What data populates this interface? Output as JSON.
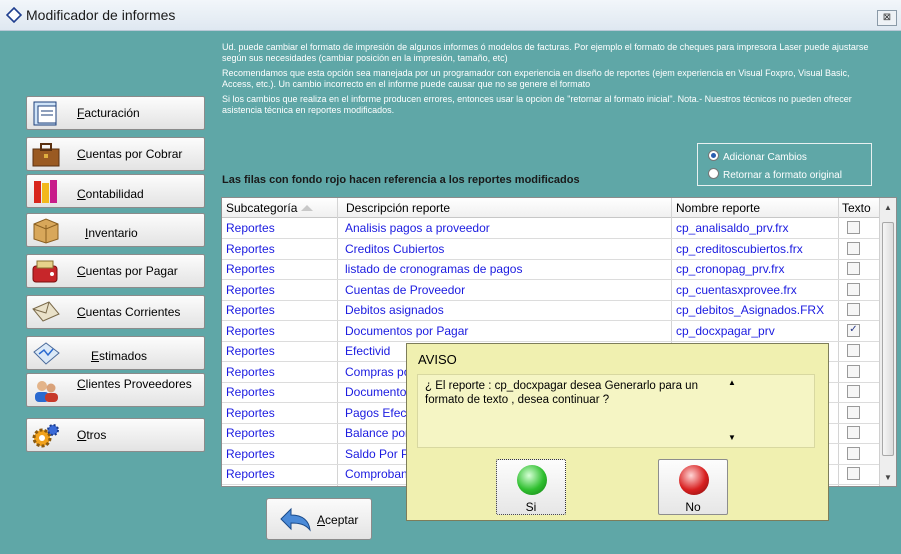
{
  "window": {
    "title": "Modificador de informes",
    "close": "⊠"
  },
  "sidebar": {
    "items": [
      {
        "label": "Facturación",
        "icon": "invoice-icon"
      },
      {
        "label": "Cuentas por Cobrar",
        "icon": "briefcase-icon"
      },
      {
        "label": "Contabilidad",
        "icon": "books-icon"
      },
      {
        "label": "Inventario",
        "icon": "box-icon"
      },
      {
        "label": "Cuentas por Pagar",
        "icon": "wallet-icon"
      },
      {
        "label": "Cuentas Corrientes",
        "icon": "envelope-icon"
      },
      {
        "label": "Estimados",
        "icon": "chart-paper-icon"
      },
      {
        "label": "Clientes Proveedores",
        "icon": "people-icon"
      },
      {
        "label": "Otros",
        "icon": "gears-icon"
      }
    ]
  },
  "info": {
    "p1": "Ud. puede cambiar el formato de impresión de algunos informes ó modelos de facturas. Por ejemplo el formato de cheques para impresora Laser puede ajustarse según sus necesidades (cambiar posición en la impresión, tamaño, etc)",
    "p2": "Recomendamos que esta opción sea manejada por un programador con experiencia en diseño de reportes (ejem experiencia en Visual Foxpro, Visual Basic, Access, etc.). Un cambio incorrecto en el informe puede causar que no se genere el formato",
    "p3": "Si los cambios que realiza en el informe producen errores, entonces usar la opcion de \"retornar al formato inicial\". Nota.- Nuestros técnicos no pueden ofrecer asistencia técnica en reportes modificados."
  },
  "options": {
    "add_changes": "Adicionar Cambios",
    "return_original": "Retornar a formato original",
    "selected": "add_changes"
  },
  "note": "Las filas con fondo rojo hacen referencia  a los reportes modificados",
  "grid": {
    "headers": [
      "Subcategoría",
      "Descripción reporte",
      "Nombre reporte",
      "Texto"
    ],
    "rows": [
      {
        "cat": "Reportes",
        "desc": "Analisis pagos a proveedor",
        "name": "cp_analisaldo_prv.frx",
        "texto": false
      },
      {
        "cat": "Reportes",
        "desc": "Creditos Cubiertos",
        "name": "cp_creditoscubiertos.frx",
        "texto": false
      },
      {
        "cat": "Reportes",
        "desc": "listado de cronogramas de pagos",
        "name": "cp_cronopag_prv.frx",
        "texto": false
      },
      {
        "cat": "Reportes",
        "desc": "Cuentas de Proveedor",
        "name": "cp_cuentasxprovee.frx",
        "texto": false
      },
      {
        "cat": "Reportes",
        "desc": "Debitos asignados",
        "name": "cp_debitos_Asignados.FRX",
        "texto": false
      },
      {
        "cat": "Reportes",
        "desc": "Documentos por Pagar",
        "name": "cp_docxpagar_prv",
        "texto": true
      },
      {
        "cat": "Reportes",
        "desc": "Efectivid",
        "name": "",
        "texto": false
      },
      {
        "cat": "Reportes",
        "desc": "Compras po",
        "name": "",
        "texto": false
      },
      {
        "cat": "Reportes",
        "desc": "Documento",
        "name": "",
        "texto": false
      },
      {
        "cat": "Reportes",
        "desc": "Pagos Efec",
        "name": "",
        "texto": false
      },
      {
        "cat": "Reportes",
        "desc": "Balance por",
        "name": "",
        "texto": false
      },
      {
        "cat": "Reportes",
        "desc": "Saldo Por P",
        "name": "",
        "texto": false
      },
      {
        "cat": "Reportes",
        "desc": "Comproban",
        "name": "",
        "texto": false
      }
    ]
  },
  "accept_button": "Aceptar",
  "dialog": {
    "title": "AVISO",
    "message": "¿ El reporte : cp_docxpagar desea Generarlo para un formato de texto , desea continuar ?",
    "yes": "Si",
    "no": "No",
    "yes_color": "#2fbf2f",
    "no_color": "#d82020"
  }
}
